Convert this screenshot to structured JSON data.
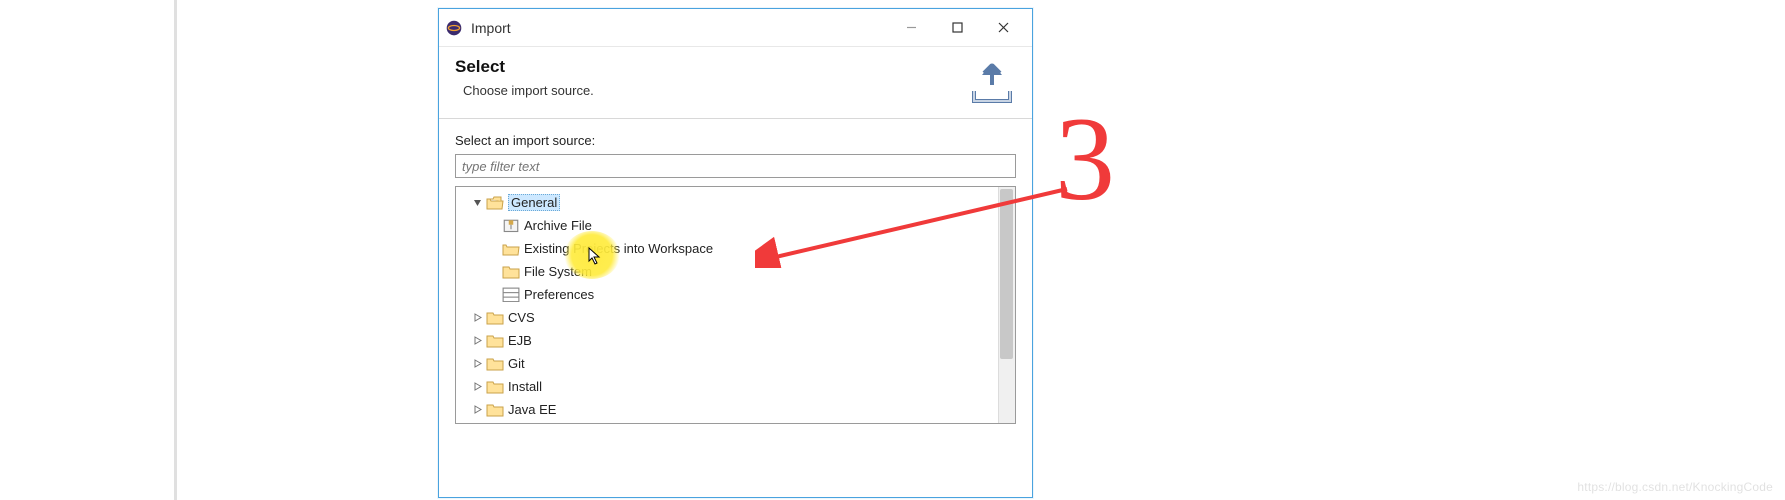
{
  "dialog": {
    "title": "Import",
    "banner": {
      "heading": "Select",
      "subtitle": "Choose import source."
    },
    "filter": {
      "label": "Select an import source:",
      "placeholder": "type filter text"
    },
    "tree": {
      "general": {
        "label": "General",
        "children": {
          "archive": "Archive File",
          "existing": "Existing Projects into Workspace",
          "filesystem": "File System",
          "preferences": "Preferences"
        }
      },
      "cvs": "CVS",
      "ejb": "EJB",
      "git": "Git",
      "install": "Install",
      "javaee": "Java EE"
    }
  },
  "annotation": {
    "step": "3"
  },
  "watermark": "https://blog.csdn.net/KnockingCode"
}
